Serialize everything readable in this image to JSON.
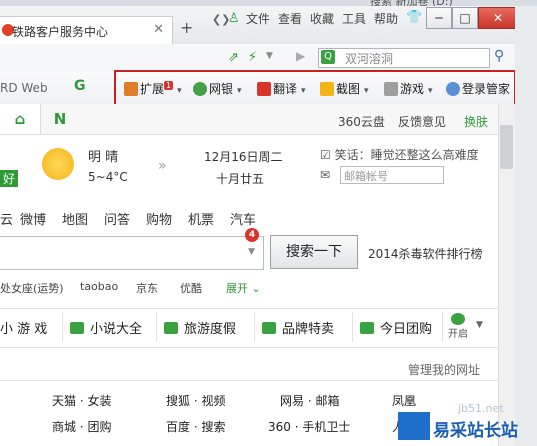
{
  "top_ghost": "搜索 新加卷 (D:)",
  "browser": {
    "tab_title": "铁路客户服务中心",
    "new_tab": "+",
    "menu": [
      "文件",
      "查看",
      "收藏",
      "工具",
      "帮助"
    ],
    "win_min": "─",
    "win_max": "□",
    "win_close": "✕",
    "search_placeholder": "双河溶洞",
    "url_partial": "RD Web"
  },
  "extensions": [
    {
      "label": "扩展",
      "badge": "1"
    },
    {
      "label": "网银"
    },
    {
      "label": "翻译"
    },
    {
      "label": "截图"
    },
    {
      "label": "游戏"
    },
    {
      "label": "登录管家"
    }
  ],
  "nav": {
    "tab2": "N",
    "links": [
      "360云盘",
      "反馈意见",
      "换肤"
    ]
  },
  "weather": {
    "condition": "明 晴",
    "temp": "5~4°C",
    "date": "12月16日周二",
    "lunar": "十月廿五",
    "joke": "笑话：睡觉还整这么高难度",
    "mail_placeholder": "邮箱帐号",
    "left_partial": "好"
  },
  "search": {
    "categories": [
      "云",
      "微博",
      "地图",
      "问答",
      "购物",
      "机票",
      "汽车"
    ],
    "button": "搜索一下",
    "badge": "4",
    "side_link": "2014杀毒软件排行榜",
    "suggestions": [
      "处女座(运势)",
      "taobao",
      "京东",
      "优酷",
      "展开"
    ]
  },
  "category_bar": [
    "小 游 戏",
    "小说大全",
    "旅游度假",
    "品牌特卖",
    "今日团购",
    "开启"
  ],
  "links_header": "管理我的网址",
  "links": [
    [
      "天猫 · 女装",
      "搜狐 · 视频",
      "网易 · 邮箱",
      "凤凰"
    ],
    [
      "商城 · 团购",
      "百度 · 搜索",
      "360 · 手机卫士",
      "人"
    ],
    [
      "",
      "",
      "",
      ""
    ]
  ],
  "watermark": {
    "text": "易采站长站",
    "small": "jb51.net"
  },
  "colors": {
    "accent_red": "#cc1f1f",
    "nav_green": "#2e9a36",
    "link_blue": "#1a5fb0"
  }
}
